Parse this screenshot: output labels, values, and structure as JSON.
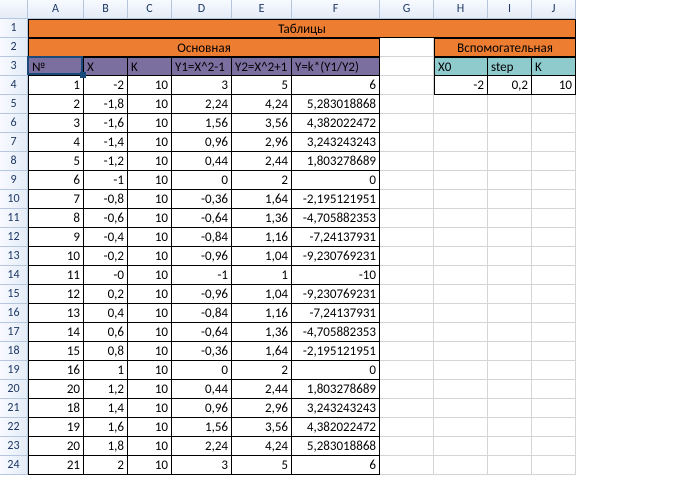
{
  "columns": [
    "",
    "A",
    "B",
    "C",
    "D",
    "E",
    "F",
    "G",
    "H",
    "I",
    "J"
  ],
  "row_count": 24,
  "title_row": {
    "main": "Таблицы"
  },
  "section_row": {
    "left": "Основная",
    "right": "Вспомогательная"
  },
  "main_headers": [
    "№",
    "X",
    "K",
    "Y1=X^2-1",
    "Y2=X^2+1",
    "Y=k*(Y1/Y2)"
  ],
  "aux_headers": [
    "X0",
    "step",
    "K"
  ],
  "aux_values": [
    "-2",
    "0,2",
    "10"
  ],
  "data": [
    [
      "1",
      "-2",
      "10",
      "3",
      "5",
      "6"
    ],
    [
      "2",
      "-1,8",
      "10",
      "2,24",
      "4,24",
      "5,283018868"
    ],
    [
      "3",
      "-1,6",
      "10",
      "1,56",
      "3,56",
      "4,382022472"
    ],
    [
      "4",
      "-1,4",
      "10",
      "0,96",
      "2,96",
      "3,243243243"
    ],
    [
      "5",
      "-1,2",
      "10",
      "0,44",
      "2,44",
      "1,803278689"
    ],
    [
      "6",
      "-1",
      "10",
      "0",
      "2",
      "0"
    ],
    [
      "7",
      "-0,8",
      "10",
      "-0,36",
      "1,64",
      "-2,195121951"
    ],
    [
      "8",
      "-0,6",
      "10",
      "-0,64",
      "1,36",
      "-4,705882353"
    ],
    [
      "9",
      "-0,4",
      "10",
      "-0,84",
      "1,16",
      "-7,24137931"
    ],
    [
      "10",
      "-0,2",
      "10",
      "-0,96",
      "1,04",
      "-9,230769231"
    ],
    [
      "11",
      "-0",
      "10",
      "-1",
      "1",
      "-10"
    ],
    [
      "12",
      "0,2",
      "10",
      "-0,96",
      "1,04",
      "-9,230769231"
    ],
    [
      "13",
      "0,4",
      "10",
      "-0,84",
      "1,16",
      "-7,24137931"
    ],
    [
      "14",
      "0,6",
      "10",
      "-0,64",
      "1,36",
      "-4,705882353"
    ],
    [
      "15",
      "0,8",
      "10",
      "-0,36",
      "1,64",
      "-2,195121951"
    ],
    [
      "16",
      "1",
      "10",
      "0",
      "2",
      "0"
    ],
    [
      "20",
      "1,2",
      "10",
      "0,44",
      "2,44",
      "1,803278689"
    ],
    [
      "18",
      "1,4",
      "10",
      "0,96",
      "2,96",
      "3,243243243"
    ],
    [
      "19",
      "1,6",
      "10",
      "1,56",
      "3,56",
      "4,382022472"
    ],
    [
      "20",
      "1,8",
      "10",
      "2,24",
      "4,24",
      "5,283018868"
    ],
    [
      "21",
      "2",
      "10",
      "3",
      "5",
      "6"
    ]
  ],
  "chart_data": {
    "type": "table",
    "title": "Таблицы",
    "main_table": {
      "columns": [
        "№",
        "X",
        "K",
        "Y1=X^2-1",
        "Y2=X^2+1",
        "Y=k*(Y1/Y2)"
      ]
    },
    "aux_table": {
      "columns": [
        "X0",
        "step",
        "K"
      ],
      "values": [
        -2,
        0.2,
        10
      ]
    }
  }
}
